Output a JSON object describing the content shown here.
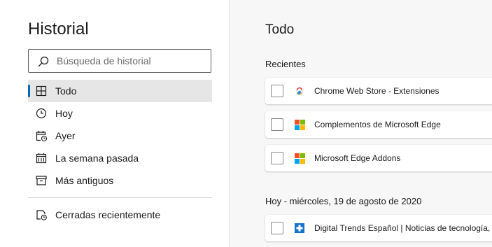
{
  "sidebar": {
    "title": "Historial",
    "search_placeholder": "Búsqueda de historial",
    "items": [
      {
        "label": "Todo",
        "icon": "grid-icon"
      },
      {
        "label": "Hoy",
        "icon": "clock-icon"
      },
      {
        "label": "Ayer",
        "icon": "calendar-clock-icon"
      },
      {
        "label": "La semana pasada",
        "icon": "calendar-icon"
      },
      {
        "label": "Más antiguos",
        "icon": "archive-icon"
      }
    ],
    "recently_closed": {
      "label": "Cerradas recientemente",
      "icon": "closed-tabs-icon"
    }
  },
  "main": {
    "title": "Todo",
    "sections": [
      {
        "label": "Recientes",
        "entries": [
          {
            "title": "Chrome Web Store - Extensiones",
            "icon": "chrome-web-store-icon"
          },
          {
            "title": "Complementos de Microsoft Edge",
            "icon": "microsoft-logo-icon"
          },
          {
            "title": "Microsoft Edge Addons",
            "icon": "microsoft-logo-icon"
          }
        ]
      },
      {
        "label": "Hoy - miércoles, 19 de agosto de 2020",
        "entries": [
          {
            "title": "Digital Trends Español | Noticias de tecnología,",
            "icon": "digital-trends-icon"
          }
        ]
      }
    ]
  },
  "colors": {
    "accent": "#0067b8",
    "active_bg": "#e6e6e6",
    "main_bg": "#f7f7f7",
    "ms_red": "#f25022",
    "ms_green": "#7fba00",
    "ms_blue": "#00a4ef",
    "ms_yellow": "#ffb900",
    "digital_trends_blue": "#1773c9"
  }
}
